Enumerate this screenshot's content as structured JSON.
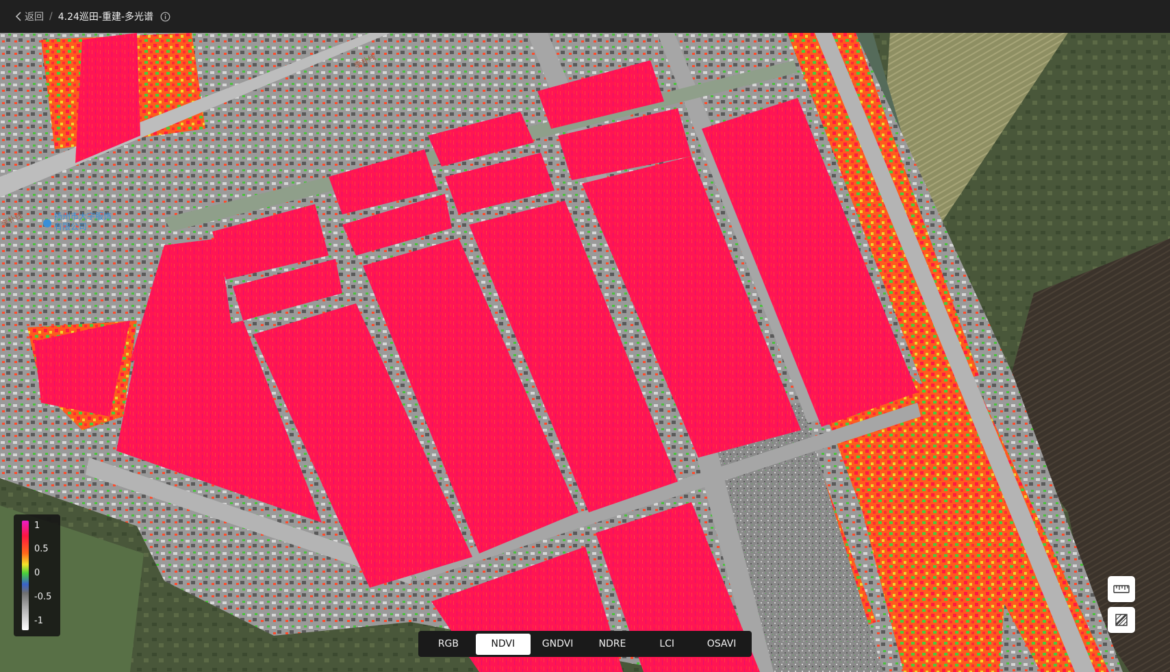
{
  "header": {
    "back_label": "返回",
    "separator": "/",
    "title": "4.24巡田-重建-多光谱"
  },
  "map": {
    "labels": {
      "road_top": "李朴线",
      "road_left": "李朴线",
      "company_line1": "扬州市大宇服饰",
      "company_line2": "有限公司"
    }
  },
  "legend": {
    "labels": [
      "1",
      "0.5",
      "0",
      "-0.5",
      "-1"
    ]
  },
  "tools": {
    "ruler_icon": "ruler-icon",
    "area_icon": "area-measure-icon"
  },
  "index_switcher": {
    "items": [
      "RGB",
      "NDVI",
      "GNDVI",
      "NDRE",
      "LCI",
      "OSAVI"
    ],
    "active": "NDVI"
  },
  "colors": {
    "ndvi_high": "#ff1553",
    "ndvi_mid": "#ff5a1e",
    "ndvi_low": "#49d23a",
    "bare": "#8a8a8a",
    "topbar": "#202020"
  }
}
